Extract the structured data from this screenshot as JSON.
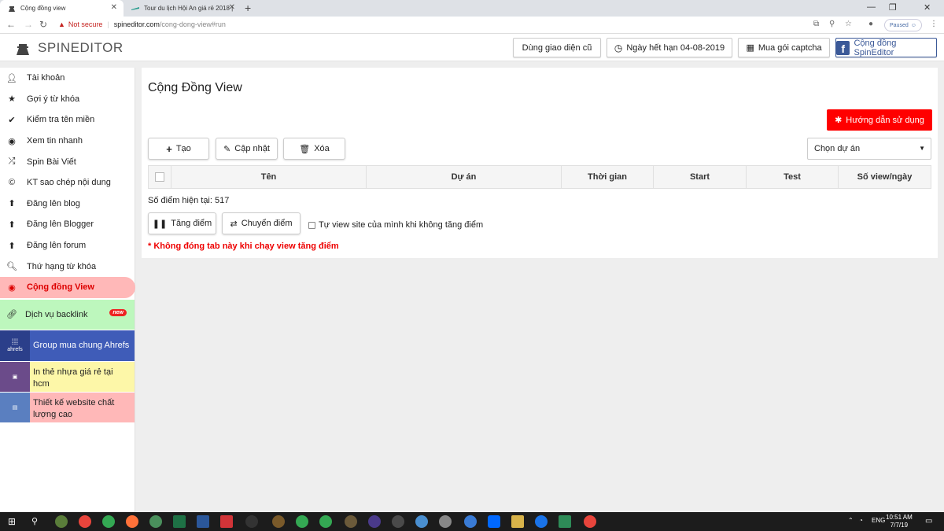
{
  "browser": {
    "tabs": [
      {
        "title": "Cộng đồng view",
        "active": true
      },
      {
        "title": "Tour du lịch Hội An giá rẻ 2018 |",
        "active": false
      }
    ],
    "new_tab": "+",
    "address": {
      "warning": "Not secure",
      "host": "spineditor.com",
      "path": "/cong-dong-view#run"
    },
    "paused_label": "Paused"
  },
  "header": {
    "logo_text": "SPINEDITOR",
    "buttons": {
      "old_ui": "Dùng giao diện cũ",
      "expiry": "Ngày hết hạn 04-08-2019",
      "captcha": "Mua gói captcha",
      "community": "Cộng đồng SpinEditor"
    }
  },
  "sidebar": {
    "items": [
      {
        "label": "Tài khoản",
        "icon": "user-icon"
      },
      {
        "label": "Gợi ý từ khóa",
        "icon": "star-icon"
      },
      {
        "label": "Kiểm tra tên miền",
        "icon": "check-icon"
      },
      {
        "label": "Xem tin nhanh",
        "icon": "eye-icon"
      },
      {
        "label": "Spin Bài Viết",
        "icon": "shuffle-icon"
      },
      {
        "label": "KT sao chép nội dung",
        "icon": "copyright-icon"
      },
      {
        "label": "Đăng lên blog",
        "icon": "upload-icon"
      },
      {
        "label": "Đăng lên Blogger",
        "icon": "upload-icon"
      },
      {
        "label": "Đăng lên forum",
        "icon": "upload-icon"
      },
      {
        "label": "Thứ hạng từ khóa",
        "icon": "search-icon"
      },
      {
        "label": "Cộng đồng View",
        "icon": "eye-icon",
        "active": true
      }
    ],
    "backlink": {
      "label": "Dịch vụ backlink",
      "badge": "new"
    },
    "ads": [
      {
        "label": "Group mua chung Ahrefs",
        "thumb_text": "ahrefs",
        "color": "#3f5cb8"
      },
      {
        "label": "In thẻ nhựa giá rẻ tại hcm",
        "color": "#fdf7a8"
      },
      {
        "label": "Thiết kế website chất lượng cao",
        "color": "#ffb8b8"
      }
    ]
  },
  "main": {
    "title": "Cộng Đồng View",
    "guide_button": "Hướng dẫn sử dụng",
    "actions": {
      "create": "Tạo",
      "update": "Cập nhật",
      "delete": "Xóa"
    },
    "project_select": "Chọn dự án",
    "table_headers": [
      "Tên",
      "Dự án",
      "Thời gian",
      "Start",
      "Test",
      "Số view/ngày"
    ],
    "score_text": "Số điểm hiện tại: 517",
    "increase_button": "Tăng điểm",
    "transfer_button": "Chuyển điểm",
    "self_view_checkbox": "Tự view site của mình khi không tăng điểm",
    "warning": "* Không đóng tab này khi chạy view tăng điểm"
  },
  "taskbar": {
    "lang": "ENG",
    "time": "10:51 AM",
    "date": "7/7/19"
  },
  "colors": {
    "accent_red": "#ff0000",
    "active_bg": "#ffb8b8",
    "fb_blue": "#3b5998"
  }
}
